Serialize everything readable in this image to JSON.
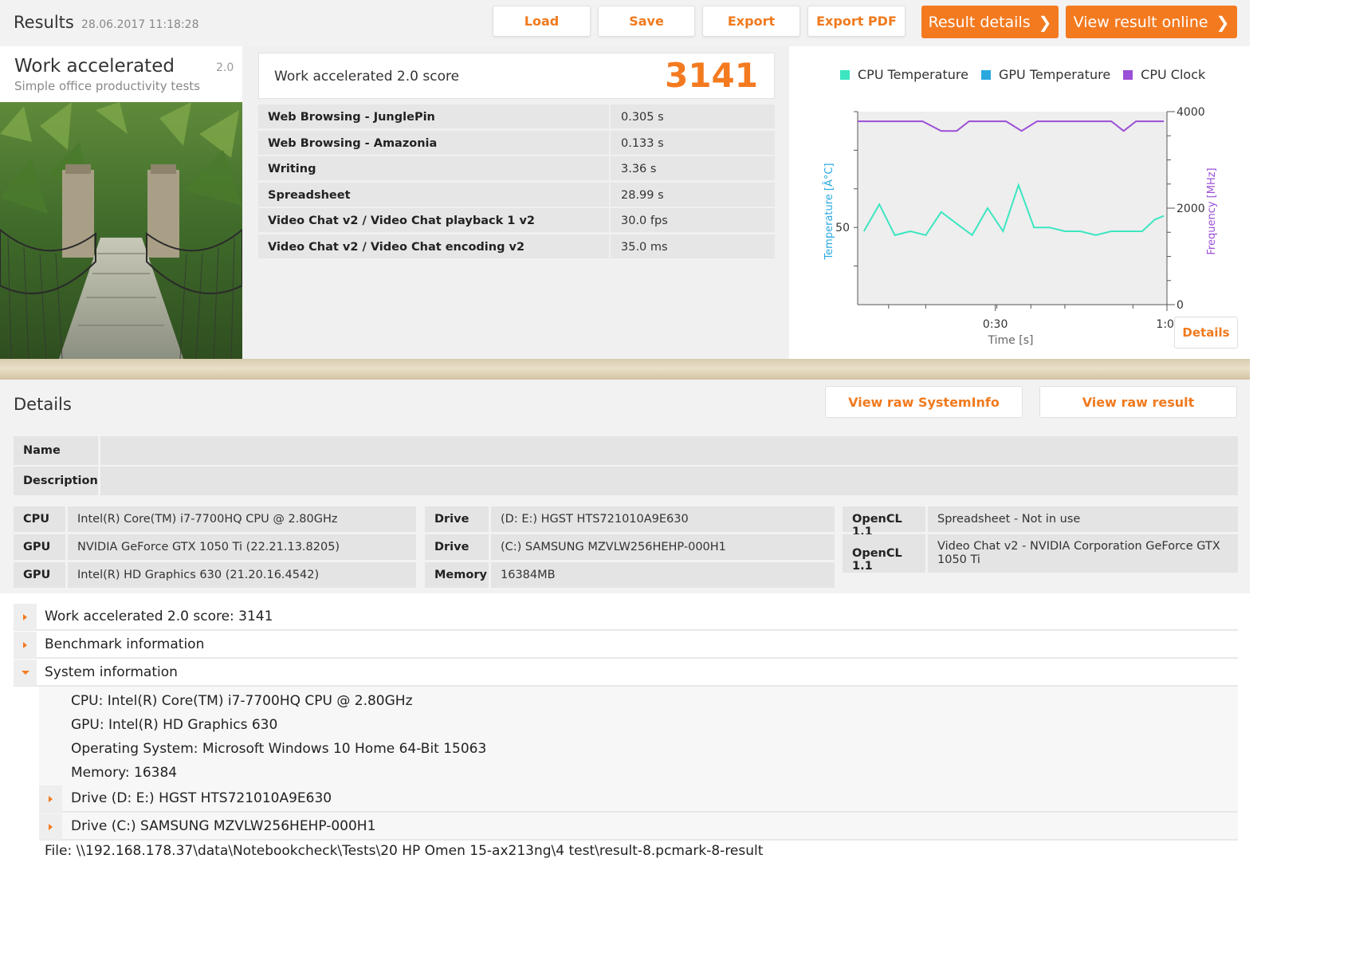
{
  "header": {
    "title": "Results",
    "timestamp": "28.06.2017 11:18:28",
    "buttons": {
      "load": "Load",
      "save": "Save",
      "export": "Export",
      "export_pdf": "Export PDF",
      "result_details": "Result details",
      "view_online": "View result online"
    }
  },
  "test": {
    "name": "Work accelerated",
    "subtitle": "Simple office productivity tests",
    "version": "2.0"
  },
  "score": {
    "label": "Work accelerated 2.0 score",
    "value": "3141",
    "subtests": [
      {
        "name": "Web Browsing - JunglePin",
        "value": "0.305 s"
      },
      {
        "name": "Web Browsing - Amazonia",
        "value": "0.133 s"
      },
      {
        "name": "Writing",
        "value": "3.36 s"
      },
      {
        "name": "Spreadsheet",
        "value": "28.99 s"
      },
      {
        "name": "Video Chat v2 / Video Chat playback 1 v2",
        "value": "30.0 fps"
      },
      {
        "name": "Video Chat v2 / Video Chat encoding v2",
        "value": "35.0 ms"
      }
    ]
  },
  "chart_data": {
    "type": "line",
    "series": [
      {
        "name": "CPU Temperature",
        "color": "#3be6c0",
        "axis": "left",
        "x": [
          2,
          7,
          12,
          17,
          22,
          27,
          32,
          37,
          42,
          47,
          52,
          57,
          62,
          67,
          72,
          77,
          82,
          87,
          92,
          96,
          99
        ],
        "values": [
          49,
          56,
          48,
          49,
          48,
          54,
          51,
          48,
          55,
          49,
          61,
          50,
          50,
          49,
          49,
          48,
          49,
          49,
          49,
          52,
          53
        ]
      },
      {
        "name": "GPU Temperature",
        "color": "#29a8e0",
        "axis": "left",
        "x": [],
        "values": []
      },
      {
        "name": "CPU Clock",
        "color": "#9b4fd6",
        "axis": "right",
        "x": [
          0,
          21,
          27,
          32,
          36,
          48,
          53,
          58,
          76,
          82,
          86,
          90,
          99
        ],
        "values": [
          3800,
          3800,
          3600,
          3600,
          3800,
          3800,
          3600,
          3800,
          3800,
          3800,
          3600,
          3800,
          3800
        ]
      }
    ],
    "xlabel": "Time [s]",
    "ylabel_left": "Temperature [Â°C]",
    "ylabel_right": "Frequency [MHz]",
    "x_ticks": [
      "0:30",
      "1:00"
    ],
    "left_ticks": [
      "50"
    ],
    "right_ticks": [
      "4000",
      "2000",
      "0"
    ],
    "xlim": [
      0,
      100
    ],
    "ylim_left": [
      30,
      80
    ],
    "ylim_right": [
      0,
      4000
    ]
  },
  "chart_button": "Details",
  "details": {
    "title": "Details",
    "buttons": {
      "raw_sysinfo": "View raw SystemInfo",
      "raw_result": "View raw result"
    },
    "name_label": "Name",
    "description_label": "Description",
    "columns": [
      [
        {
          "k": "CPU",
          "v": "Intel(R) Core(TM) i7-7700HQ CPU @ 2.80GHz"
        },
        {
          "k": "GPU",
          "v": "NVIDIA GeForce GTX 1050 Ti (22.21.13.8205)"
        },
        {
          "k": "GPU",
          "v": "Intel(R) HD Graphics 630 (21.20.16.4542)"
        }
      ],
      [
        {
          "k": "Drive",
          "v": "(D: E:) HGST HTS721010A9E630"
        },
        {
          "k": "Drive",
          "v": "(C:) SAMSUNG MZVLW256HEHP-000H1"
        },
        {
          "k": "Memory",
          "v": "16384MB"
        }
      ],
      [
        {
          "k": "OpenCL 1.1",
          "v": "Spreadsheet - Not in use"
        },
        {
          "k": "OpenCL 1.1",
          "v": "Video Chat v2 - NVIDIA Corporation GeForce GTX 1050 Ti"
        }
      ]
    ]
  },
  "tree": {
    "items": [
      "Work accelerated 2.0 score: 3141",
      "Benchmark information",
      "System information"
    ],
    "system_lines": [
      "CPU: Intel(R) Core(TM) i7-7700HQ CPU @ 2.80GHz",
      "GPU: Intel(R) HD Graphics 630",
      "Operating System: Microsoft Windows 10 Home 64-Bit 15063",
      "Memory: 16384"
    ],
    "drives": [
      "Drive (D: E:) HGST HTS721010A9E630",
      "Drive (C:) SAMSUNG MZVLW256HEHP-000H1"
    ],
    "file": "File: \\\\192.168.178.37\\data\\Notebookcheck\\Tests\\20 HP Omen 15-ax213ng\\4 test\\result-8.pcmark-8-result"
  }
}
